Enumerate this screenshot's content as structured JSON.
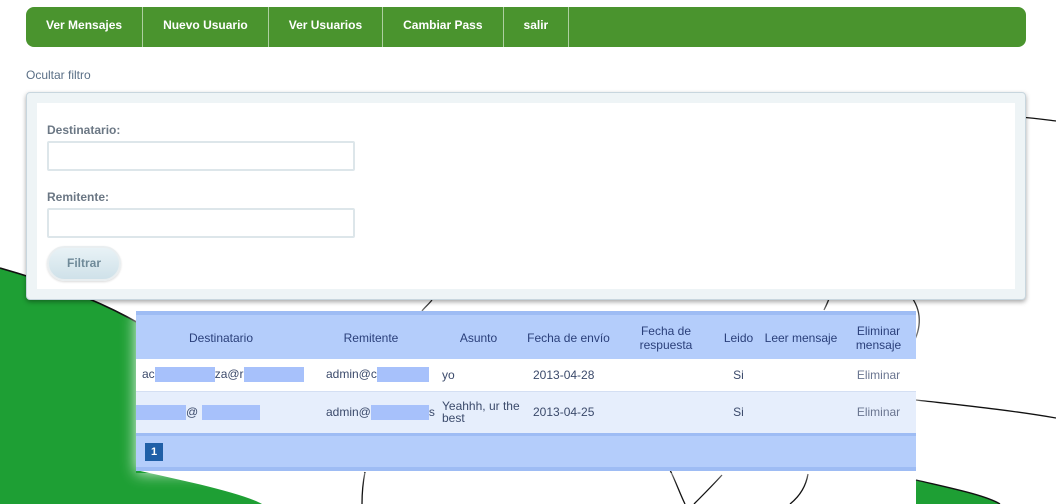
{
  "nav": {
    "items": [
      "Ver Mensajes",
      "Nuevo Usuario",
      "Ver Usuarios",
      "Cambiar Pass",
      "salir"
    ]
  },
  "filter": {
    "toggle_label": "Ocultar filtro",
    "destinatario_label": "Destinatario:",
    "destinatario_value": "",
    "remitente_label": "Remitente:",
    "remitente_value": "",
    "button_label": "Filtrar"
  },
  "table": {
    "headers": [
      "Destinatario",
      "Remitente",
      "Asunto",
      "Fecha de envío",
      "Fecha de respuesta",
      "Leido",
      "Leer mensaje",
      "Eliminar mensaje"
    ],
    "rows": [
      {
        "destinatario_prefix": "ac",
        "destinatario_mid": "za@r",
        "destinatario_suffix": "",
        "remitente_prefix": "admin@c",
        "remitente_suffix": "",
        "asunto": "yo",
        "fecha_envio": "2013-04-28",
        "fecha_respuesta": "",
        "leido": "Si",
        "leer": "",
        "eliminar": "Eliminar"
      },
      {
        "destinatario_prefix": "",
        "destinatario_mid": "@ ",
        "destinatario_suffix": "",
        "remitente_prefix": "admin@",
        "remitente_suffix": "s",
        "asunto": "Yeahhh, ur the best",
        "fecha_envio": "2013-04-25",
        "fecha_respuesta": "",
        "leido": "Si",
        "leer": "",
        "eliminar": "Eliminar"
      }
    ]
  },
  "pagination": {
    "current_page": "1"
  },
  "colors": {
    "nav_green": "#4a942e",
    "bg_green": "#1e9f34",
    "table_header": "#b4cdfb",
    "redaction": "#a7c1fb"
  }
}
